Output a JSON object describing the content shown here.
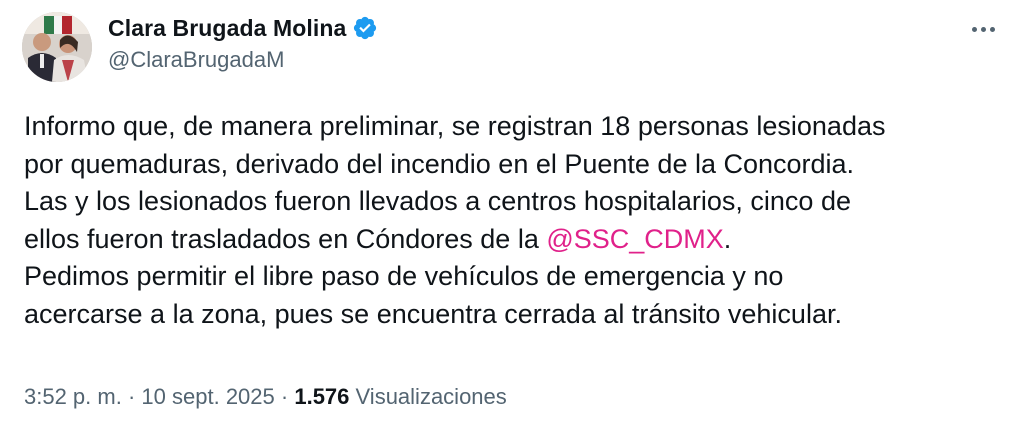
{
  "author": {
    "display_name": "Clara Brugada Molina",
    "handle": "@ClaraBrugadaM",
    "verified": true
  },
  "tweet": {
    "lines": [
      "Informo que, de manera preliminar, se registran 18 personas lesionadas",
      "por quemaduras, derivado del incendio en el Puente de la Concordia.",
      "Las y los lesionados fueron llevados a centros hospitalarios, cinco de",
      "ellos fueron trasladados en Cóndores de la ",
      "Pedimos permitir el libre paso de vehículos de emergencia y no",
      "acercarse a la zona, pues se encuentra cerrada al tránsito vehicular."
    ],
    "mention": "@SSC_CDMX",
    "mention_line_suffix": "."
  },
  "meta": {
    "time": "3:52 p. m.",
    "separator": "·",
    "date": "10 sept. 2025",
    "views_count": "1.576",
    "views_label": "Visualizaciones"
  },
  "icons": {
    "verified": "verified-badge-icon",
    "more": "more-options-icon"
  },
  "colors": {
    "verified_blue": "#1d9bf0",
    "mention": "#e0218a",
    "secondary_text": "#536471",
    "primary_text": "#0f1419"
  }
}
